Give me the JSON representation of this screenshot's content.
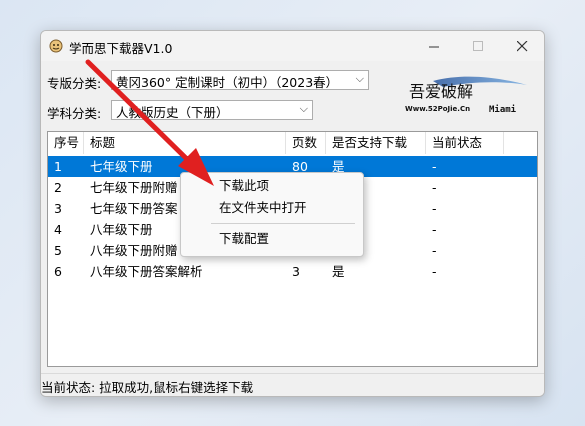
{
  "window": {
    "title": "学而思下载器V1.0"
  },
  "filters": {
    "edition_label": "专版分类:",
    "edition_value": "黄冈360° 定制课时（初中）（2023春）",
    "subject_label": "学科分类:",
    "subject_value": "人教版历史（下册）"
  },
  "logo": {
    "main_text": "吾爱破解",
    "url_text": "Www.52PoJie.Cn",
    "extra_text": "Miami"
  },
  "table": {
    "headers": [
      "序号",
      "标题",
      "页数",
      "是否支持下载",
      "当前状态"
    ],
    "rows": [
      {
        "no": "1",
        "title": "七年级下册",
        "pages": "80",
        "download": "是",
        "status": "-"
      },
      {
        "no": "2",
        "title": "七年级下册附赠",
        "pages": "",
        "download": "",
        "status": "-"
      },
      {
        "no": "3",
        "title": "七年级下册答案",
        "pages": "",
        "download": "",
        "status": "-"
      },
      {
        "no": "4",
        "title": "八年级下册",
        "pages": "",
        "download": "",
        "status": "-"
      },
      {
        "no": "5",
        "title": "八年级下册附赠",
        "pages": "34",
        "download": "是",
        "status": "-"
      },
      {
        "no": "6",
        "title": "八年级下册答案解析",
        "pages": "3",
        "download": "是",
        "status": "-"
      }
    ]
  },
  "context_menu": {
    "items": [
      "下载此项",
      "在文件夹中打开",
      "下载配置"
    ]
  },
  "status": {
    "text": "当前状态:  拉取成功,鼠标右键选择下载"
  },
  "colors": {
    "selection": "#0078d7",
    "annotation_arrow": "#e02020"
  }
}
